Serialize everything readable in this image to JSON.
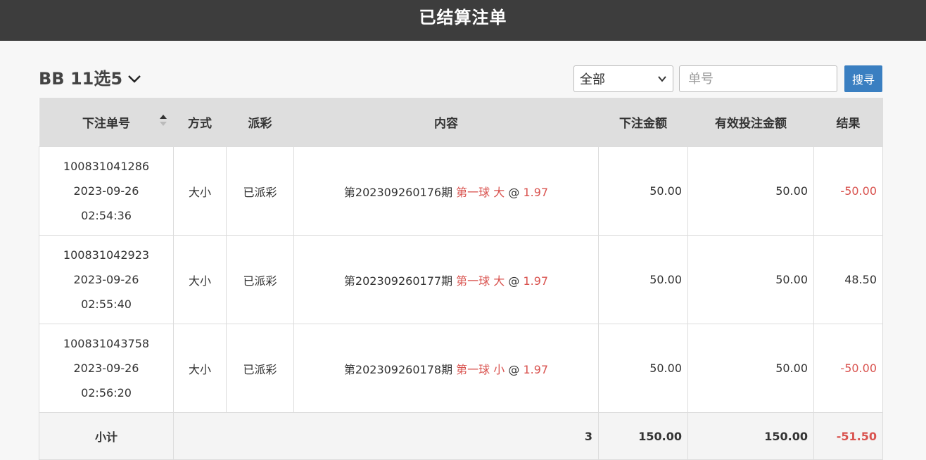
{
  "header": {
    "title": "已结算注单"
  },
  "toolbar": {
    "game_title": "BB 11选5",
    "filter_value": "全部",
    "order_placeholder": "单号",
    "search_label": "搜寻"
  },
  "table": {
    "columns": [
      "下注单号",
      "方式",
      "派彩",
      "内容",
      "下注金额",
      "有效投注金额",
      "结果"
    ],
    "rows": [
      {
        "order_no": "100831041286",
        "date": "2023-09-26",
        "time": "02:54:36",
        "method": "大小",
        "payout": "已派彩",
        "period": "第202309260176期",
        "bet": "第一球 大",
        "at": "@",
        "odds": "1.97",
        "amount": "50.00",
        "valid": "50.00",
        "result": "-50.00"
      },
      {
        "order_no": "100831042923",
        "date": "2023-09-26",
        "time": "02:55:40",
        "method": "大小",
        "payout": "已派彩",
        "period": "第202309260177期",
        "bet": "第一球 大",
        "at": "@",
        "odds": "1.97",
        "amount": "50.00",
        "valid": "50.00",
        "result": "48.50"
      },
      {
        "order_no": "100831043758",
        "date": "2023-09-26",
        "time": "02:56:20",
        "method": "大小",
        "payout": "已派彩",
        "period": "第202309260178期",
        "bet": "第一球 小",
        "at": "@",
        "odds": "1.97",
        "amount": "50.00",
        "valid": "50.00",
        "result": "-50.00"
      }
    ],
    "subtotal": {
      "label": "小计",
      "count": "3",
      "amount": "150.00",
      "valid": "150.00",
      "result": "-51.50"
    }
  },
  "colors": {
    "header_bg": "#3d3d3d",
    "accent": "#3a7fc1",
    "negative": "#d9534f"
  }
}
